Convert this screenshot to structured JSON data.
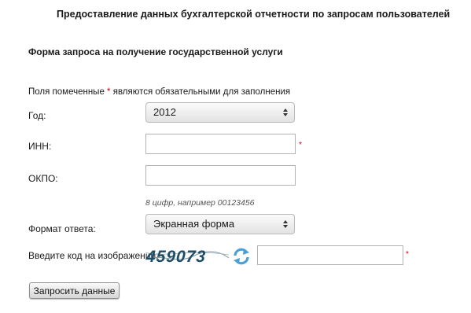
{
  "page_title": "Предоставление данных бухгалтерской отчетности по запросам пользователей",
  "form_title": "Форма запроса на получение государственной услуги",
  "required_note": {
    "before": "Поля помеченные ",
    "star": "*",
    "after": " являются обязательными для заполнения"
  },
  "year": {
    "label": "Год:",
    "selected": "2012"
  },
  "inn": {
    "label": "ИНН:",
    "value": "",
    "required_mark": "*"
  },
  "okpo": {
    "label": "ОКПО:",
    "value": "",
    "hint": "8 цифр, например 00123456"
  },
  "format": {
    "label": "Формат ответа:",
    "selected": "Экранная форма"
  },
  "captcha": {
    "label": "Введите код на изображении:",
    "code": "459073",
    "value": "",
    "required_mark": "*"
  },
  "submit_label": "Запросить данные",
  "colors": {
    "required": "#d0021b",
    "captcha_text": "#1f4d66",
    "refresh_icon": "#4a9fd6"
  }
}
